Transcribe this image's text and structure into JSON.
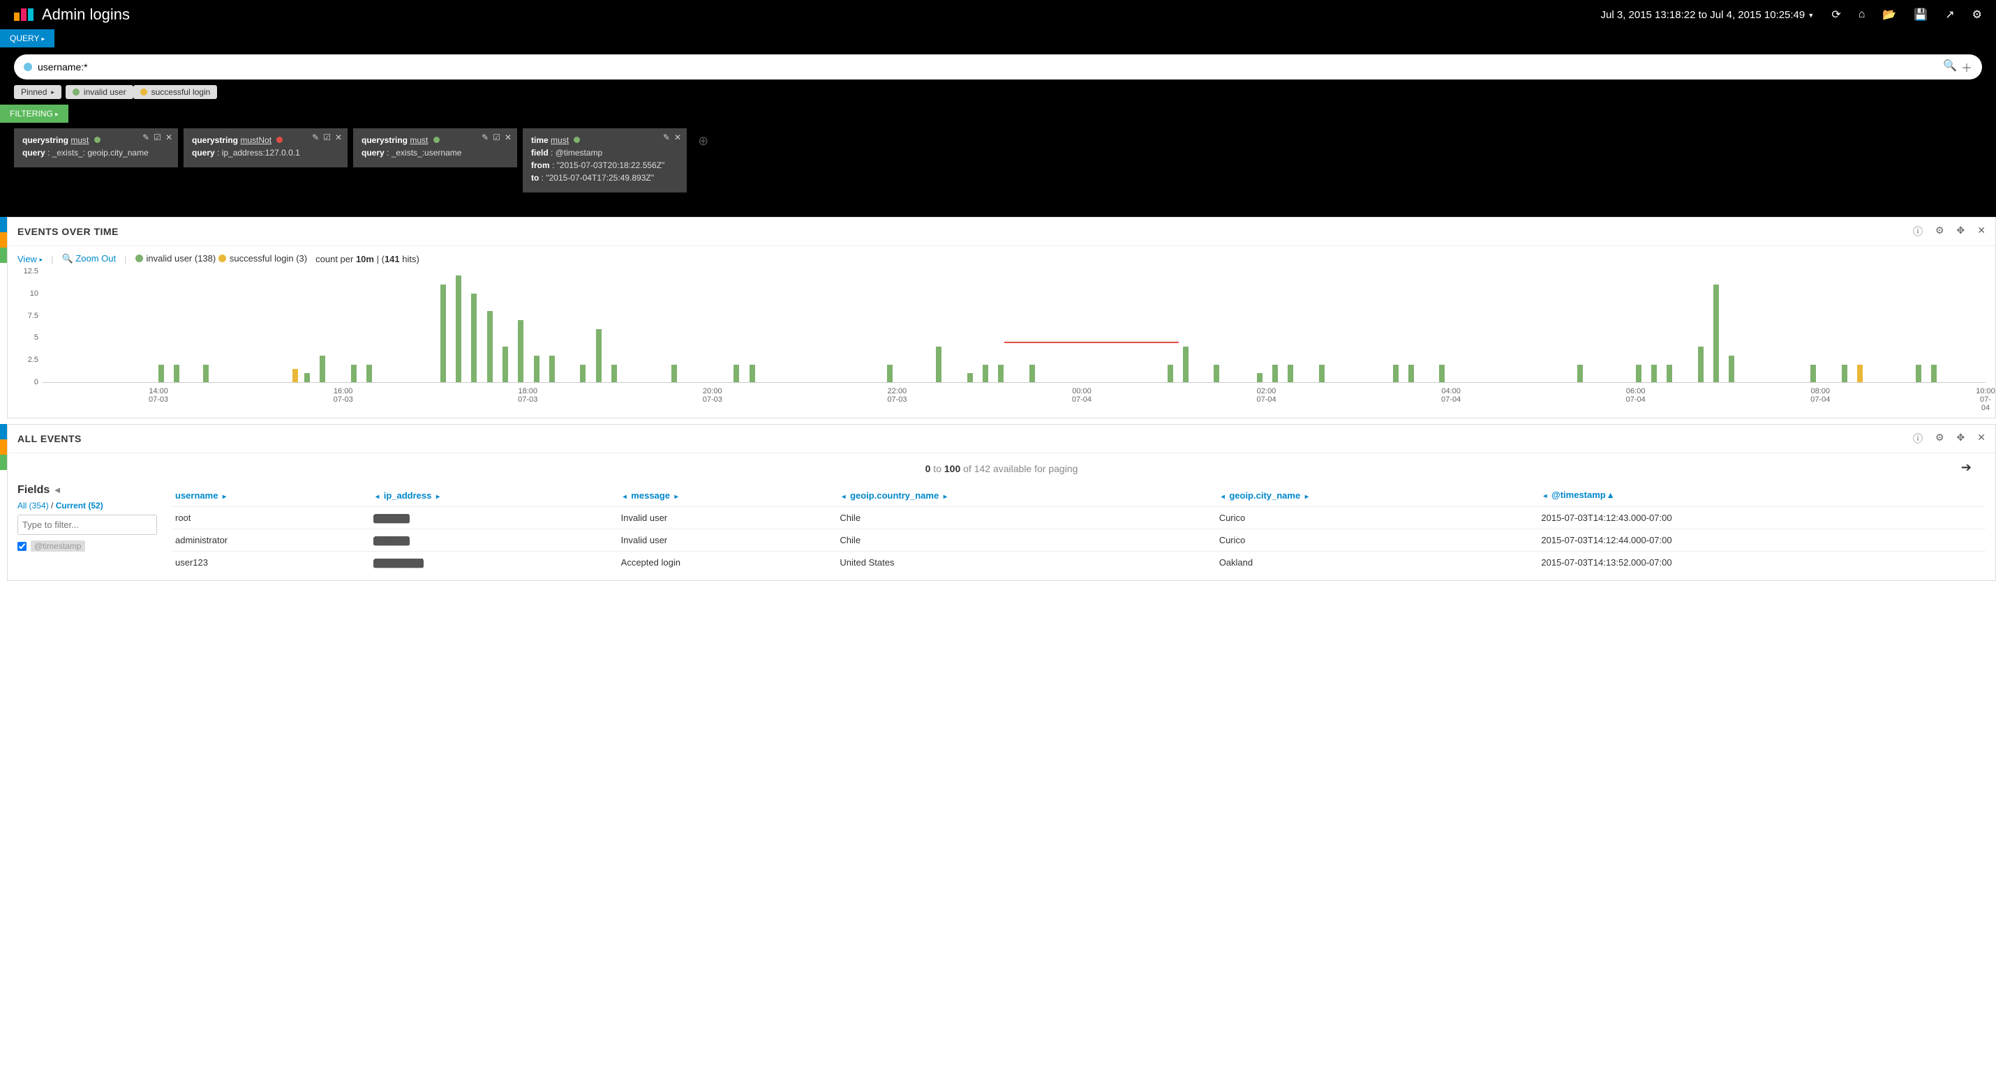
{
  "header": {
    "title": "Admin logins",
    "time_range": "Jul 3, 2015 13:18:22 to Jul 4, 2015 10:25:49"
  },
  "query": {
    "button_label": "QUERY",
    "search_value": "username:*",
    "pinned_label": "Pinned",
    "pills": [
      {
        "label": "invalid user",
        "color": "green"
      },
      {
        "label": "successful login",
        "color": "orange"
      }
    ]
  },
  "filtering": {
    "button_label": "FILTERING",
    "cards": [
      {
        "type": "querystring",
        "mode": "must",
        "dot": "green",
        "lines": [
          "query : _exists_: geoip.city_name"
        ]
      },
      {
        "type": "querystring",
        "mode": "mustNot",
        "dot": "red",
        "lines": [
          "query : ip_address:127.0.0.1"
        ]
      },
      {
        "type": "querystring",
        "mode": "must",
        "dot": "green",
        "lines": [
          "query : _exists_:username"
        ]
      },
      {
        "type": "time",
        "mode": "must",
        "dot": "green",
        "lines": [
          "field : @timestamp",
          "from : \"2015-07-03T20:18:22.556Z\"",
          "to : \"2015-07-04T17:25:49.893Z\""
        ],
        "simple": true
      }
    ]
  },
  "events_over_time": {
    "title": "EVENTS OVER TIME",
    "view_label": "View",
    "zoom_label": "Zoom Out",
    "legend": [
      {
        "label": "invalid user (138)",
        "color": "green"
      },
      {
        "label": "successful login (3)",
        "color": "orange"
      }
    ],
    "interval_prefix": "count per",
    "interval_bold": "10m",
    "hits_prefix": "| (",
    "hits_bold": "141",
    "hits_suffix": " hits)"
  },
  "chart_data": {
    "type": "bar",
    "ylabel": "",
    "xlabel": "",
    "ylim": [
      0,
      12.5
    ],
    "yticks": [
      0,
      2.5,
      5.0,
      7.5,
      10.0,
      12.5
    ],
    "xticks": [
      {
        "pos": 6.0,
        "t": "14:00",
        "d": "07-03"
      },
      {
        "pos": 15.5,
        "t": "16:00",
        "d": "07-03"
      },
      {
        "pos": 25.0,
        "t": "18:00",
        "d": "07-03"
      },
      {
        "pos": 34.5,
        "t": "20:00",
        "d": "07-03"
      },
      {
        "pos": 44.0,
        "t": "22:00",
        "d": "07-03"
      },
      {
        "pos": 53.5,
        "t": "00:00",
        "d": "07-04"
      },
      {
        "pos": 63.0,
        "t": "02:00",
        "d": "07-04"
      },
      {
        "pos": 72.5,
        "t": "04:00",
        "d": "07-04"
      },
      {
        "pos": 82.0,
        "t": "06:00",
        "d": "07-04"
      },
      {
        "pos": 91.5,
        "t": "08:00",
        "d": "07-04"
      },
      {
        "pos": 100.0,
        "t": "10:00",
        "d": "07-04"
      }
    ],
    "series": [
      {
        "name": "invalid user",
        "color": "g",
        "bars": [
          {
            "x": 6.0,
            "v": 2
          },
          {
            "x": 6.8,
            "v": 2
          },
          {
            "x": 8.3,
            "v": 2
          },
          {
            "x": 13.5,
            "v": 1
          },
          {
            "x": 14.3,
            "v": 3
          },
          {
            "x": 15.9,
            "v": 2
          },
          {
            "x": 16.7,
            "v": 2
          },
          {
            "x": 20.5,
            "v": 11
          },
          {
            "x": 21.3,
            "v": 12
          },
          {
            "x": 22.1,
            "v": 10
          },
          {
            "x": 22.9,
            "v": 8
          },
          {
            "x": 23.7,
            "v": 4
          },
          {
            "x": 24.5,
            "v": 7
          },
          {
            "x": 25.3,
            "v": 3
          },
          {
            "x": 26.1,
            "v": 3
          },
          {
            "x": 27.7,
            "v": 2
          },
          {
            "x": 28.5,
            "v": 6
          },
          {
            "x": 29.3,
            "v": 2
          },
          {
            "x": 32.4,
            "v": 2
          },
          {
            "x": 35.6,
            "v": 2
          },
          {
            "x": 36.4,
            "v": 2
          },
          {
            "x": 43.5,
            "v": 2
          },
          {
            "x": 46.0,
            "v": 4
          },
          {
            "x": 47.6,
            "v": 1
          },
          {
            "x": 48.4,
            "v": 2
          },
          {
            "x": 49.2,
            "v": 2
          },
          {
            "x": 50.8,
            "v": 2
          },
          {
            "x": 57.9,
            "v": 2
          },
          {
            "x": 58.7,
            "v": 4
          },
          {
            "x": 60.3,
            "v": 2
          },
          {
            "x": 62.5,
            "v": 1
          },
          {
            "x": 63.3,
            "v": 2
          },
          {
            "x": 64.1,
            "v": 2
          },
          {
            "x": 65.7,
            "v": 2
          },
          {
            "x": 69.5,
            "v": 2
          },
          {
            "x": 70.3,
            "v": 2
          },
          {
            "x": 71.9,
            "v": 2
          },
          {
            "x": 79.0,
            "v": 2
          },
          {
            "x": 82.0,
            "v": 2
          },
          {
            "x": 82.8,
            "v": 2
          },
          {
            "x": 83.6,
            "v": 2
          },
          {
            "x": 85.2,
            "v": 4
          },
          {
            "x": 86.0,
            "v": 11
          },
          {
            "x": 86.8,
            "v": 3
          },
          {
            "x": 91.0,
            "v": 2
          },
          {
            "x": 92.6,
            "v": 2
          },
          {
            "x": 96.4,
            "v": 2
          },
          {
            "x": 97.2,
            "v": 2
          }
        ]
      },
      {
        "name": "successful login",
        "color": "o",
        "bars": [
          {
            "x": 12.9,
            "v": 1.5
          },
          {
            "x": 93.4,
            "v": 2
          }
        ]
      }
    ],
    "redline": {
      "x1": 49.5,
      "x2": 58.5,
      "y": 4.4
    }
  },
  "all_events": {
    "title": "ALL EVENTS",
    "paging": {
      "from": "0",
      "to": "100",
      "of_text": "of 142 available for paging"
    },
    "fields": {
      "title": "Fields",
      "all_label": "All (354)",
      "current_label": "Current (52)",
      "filter_placeholder": "Type to filter...",
      "first_field": "@timestamp"
    },
    "columns": [
      "username",
      "ip_address",
      "message",
      "geoip.country_name",
      "geoip.city_name",
      "@timestamp"
    ],
    "sort_col": "@timestamp",
    "sort_dir": "asc",
    "rows": [
      {
        "username": "root",
        "ip": "███████",
        "message": "Invalid user",
        "country": "Chile",
        "city": "Curico",
        "ts": "2015-07-03T14:12:43.000-07:00"
      },
      {
        "username": "administrator",
        "ip": "███████",
        "message": "Invalid user",
        "country": "Chile",
        "city": "Curico",
        "ts": "2015-07-03T14:12:44.000-07:00"
      },
      {
        "username": "user123",
        "ip": "██████████",
        "message": "Accepted login",
        "country": "United States",
        "city": "Oakland",
        "ts": "2015-07-03T14:13:52.000-07:00"
      }
    ]
  }
}
